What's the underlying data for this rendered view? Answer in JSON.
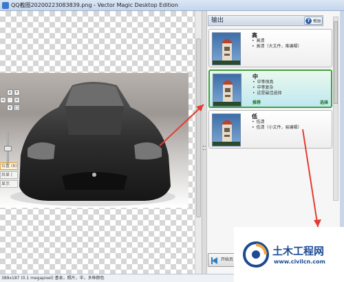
{
  "window": {
    "title": "QQ截图20200223083839.png - Vector Magic Desktop Edition"
  },
  "canvas": {
    "nav_up": "∧",
    "nav_left": "<",
    "nav_right": ">",
    "nav_down": "∨",
    "side_buttons": [
      "位置 (8)",
      "共显 (",
      "显示"
    ]
  },
  "output_panel": {
    "header": "输出",
    "help_label": "帮助",
    "options": [
      {
        "title": "高",
        "bullets": [
          "高清",
          "高清（大文件，难编辑）"
        ],
        "selected": false,
        "recommend_label": "",
        "select_label": ""
      },
      {
        "title": "中",
        "bullets": [
          "中等保真",
          "中等复杂",
          "这是最佳选择"
        ],
        "selected": true,
        "recommend_label": "推荐",
        "select_label": "选择"
      },
      {
        "title": "低",
        "bullets": [
          "低清",
          "低清（小文件，易编辑）"
        ],
        "selected": false,
        "recommend_label": "",
        "select_label": ""
      }
    ],
    "start_over_label": "开始页"
  },
  "statusbar": {
    "text": "389x187 (0.1 megapixel)  基本，照片，中，多种颜色"
  },
  "watermark": {
    "text": "土木工程网",
    "url": "www.civilcn.com"
  },
  "colors": {
    "selected_border": "#3ea03c",
    "annotation": "#e53a2f",
    "watermark_blue": "#1c4b94"
  }
}
